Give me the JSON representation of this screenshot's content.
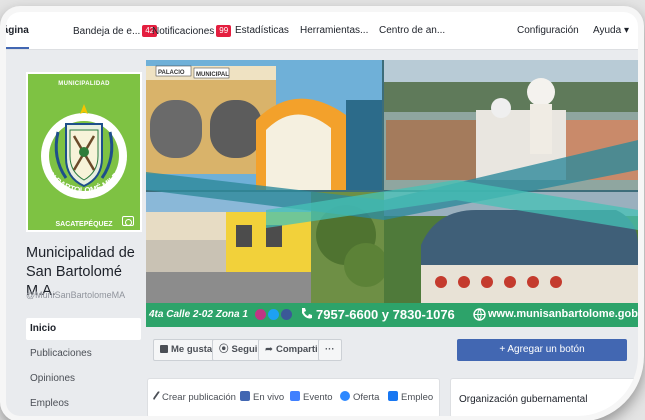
{
  "topnav": {
    "items": [
      {
        "label": "Página"
      },
      {
        "label": "Bandeja de e...",
        "badge": "42"
      },
      {
        "label": "Notificaciones",
        "badge": "99"
      },
      {
        "label": "Estadísticas"
      },
      {
        "label": "Herramientas..."
      },
      {
        "label": "Centro de an..."
      }
    ],
    "settings_label": "Configuración",
    "help_label": "Ayuda ▾"
  },
  "profile": {
    "top_label": "MUNICIPALIDAD",
    "arc_text": "SAN BARTOLOMÉ MILPAS ALTAS",
    "bottom_label": "SACATEPÉQUEZ",
    "name": "Municipalidad de San Bartolomé M.A.",
    "handle": "@MuniSanBartolomeMA"
  },
  "leftnav": [
    "Inicio",
    "Publicaciones",
    "Opiniones",
    "Empleos"
  ],
  "cover": {
    "sign_text_1": "PALACIO",
    "sign_text_2": "MUNICIPAL",
    "address": "4ta Calle 2-02 Zona 1",
    "phone": "7957-6600 y 7830-1076",
    "website": "www.munisanbartolome.gob.gt"
  },
  "actions": {
    "like": "Me gusta",
    "follow": "Seguir",
    "share": "Compartir",
    "more": "···",
    "add_button": "+ Agregar un botón"
  },
  "composer": {
    "tabs": [
      "Crear publicación",
      "En vivo",
      "Evento",
      "Oferta",
      "Empleo"
    ]
  },
  "category": "Organización gubernamental",
  "colors": {
    "accent": "#4267b2",
    "badge": "#e41e3f",
    "profile_green": "#7ec243",
    "contact_green": "#2da36a"
  }
}
